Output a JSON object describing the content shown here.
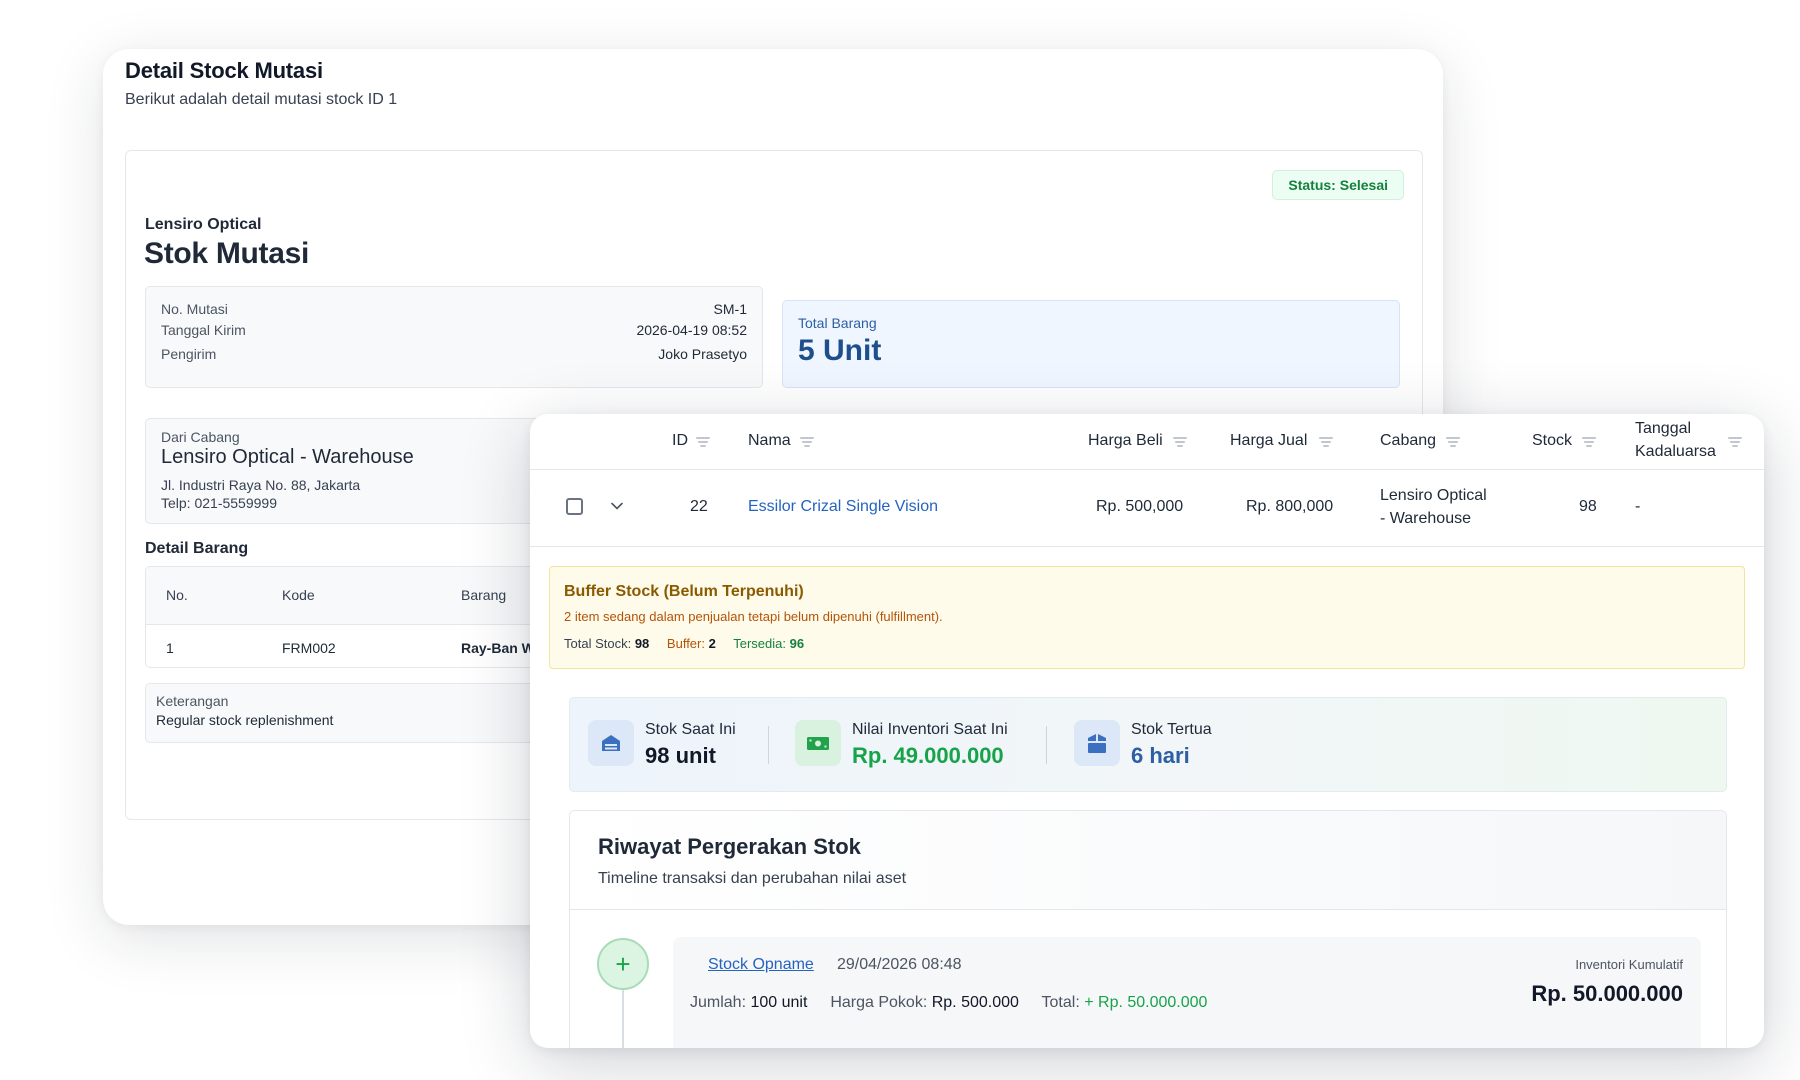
{
  "detail": {
    "title": "Detail Stock Mutasi",
    "subtitle": "Berikut adalah detail mutasi stock ID 1",
    "status": "Status: Selesai",
    "company": "Lensiro Optical",
    "doc_title": "Stok Mutasi",
    "meta": [
      {
        "label": "No. Mutasi",
        "value": "SM-1"
      },
      {
        "label": "Tanggal Kirim",
        "value": "2026-04-19 08:52"
      },
      {
        "label": "Pengirim",
        "value": "Joko Prasetyo"
      }
    ],
    "total": {
      "label": "Total Barang",
      "value": "5 Unit"
    },
    "from": {
      "label": "Dari Cabang",
      "name": "Lensiro Optical - Warehouse",
      "address": "Jl. Industri Raya No. 88, Jakarta",
      "phone": "Telp: 021-5559999"
    },
    "items_label": "Detail Barang",
    "items_columns": [
      "No.",
      "Kode",
      "Barang"
    ],
    "items_rows": [
      {
        "no": "1",
        "kode": "FRM002",
        "barang": "Ray-Ban W"
      }
    ],
    "note": {
      "label": "Keterangan",
      "value": "Regular stock replenishment"
    }
  },
  "product_table": {
    "columns": {
      "id": "ID",
      "nama": "Nama",
      "harga_beli": "Harga Beli",
      "harga_jual": "Harga Jual",
      "cabang": "Cabang",
      "stock": "Stock",
      "tanggal_line1": "Tanggal",
      "tanggal_line2": "Kadaluarsa"
    },
    "row": {
      "id": "22",
      "nama": "Essilor Crizal Single Vision",
      "harga_beli": "Rp. 500,000",
      "harga_jual": "Rp. 800,000",
      "cabang_line1": "Lensiro Optical",
      "cabang_line2": "- Warehouse",
      "stock": "98",
      "tanggal": "-"
    }
  },
  "buffer": {
    "title": "Buffer Stock (Belum Terpenuhi)",
    "description": "2 item sedang dalam penjualan tetapi belum dipenuhi (fulfillment).",
    "total_label": "Total Stock:",
    "total_value": "98",
    "buffer_label": "Buffer:",
    "buffer_value": "2",
    "available_label": "Tersedia:",
    "available_value": "96"
  },
  "metrics": [
    {
      "label": "Stok Saat Ini",
      "value": "98 unit",
      "icon": "warehouse-icon"
    },
    {
      "label": "Nilai Inventori Saat Ini",
      "value": "Rp. 49.000.000",
      "icon": "money-icon"
    },
    {
      "label": "Stok Tertua",
      "value": "6 hari",
      "icon": "box-icon"
    }
  ],
  "history": {
    "title": "Riwayat Pergerakan Stok",
    "subtitle": "Timeline transaksi dan perubahan nilai aset",
    "entries": [
      {
        "icon": "+",
        "type": "Stock Opname",
        "date": "29/04/2026 08:48",
        "qty_label": "Jumlah:",
        "qty_value": "100 unit",
        "cost_label": "Harga Pokok:",
        "cost_value": "Rp. 500.000",
        "total_label": "Total:",
        "total_value": "+ Rp. 50.000.000",
        "cum_label": "Inventori Kumulatif",
        "cum_value": "Rp. 50.000.000"
      }
    ]
  },
  "colors": {
    "link": "#2563c0",
    "positive": "#16a34a",
    "accent_blue": "#1e4e8c",
    "buffer_bg": "#fefbea"
  }
}
